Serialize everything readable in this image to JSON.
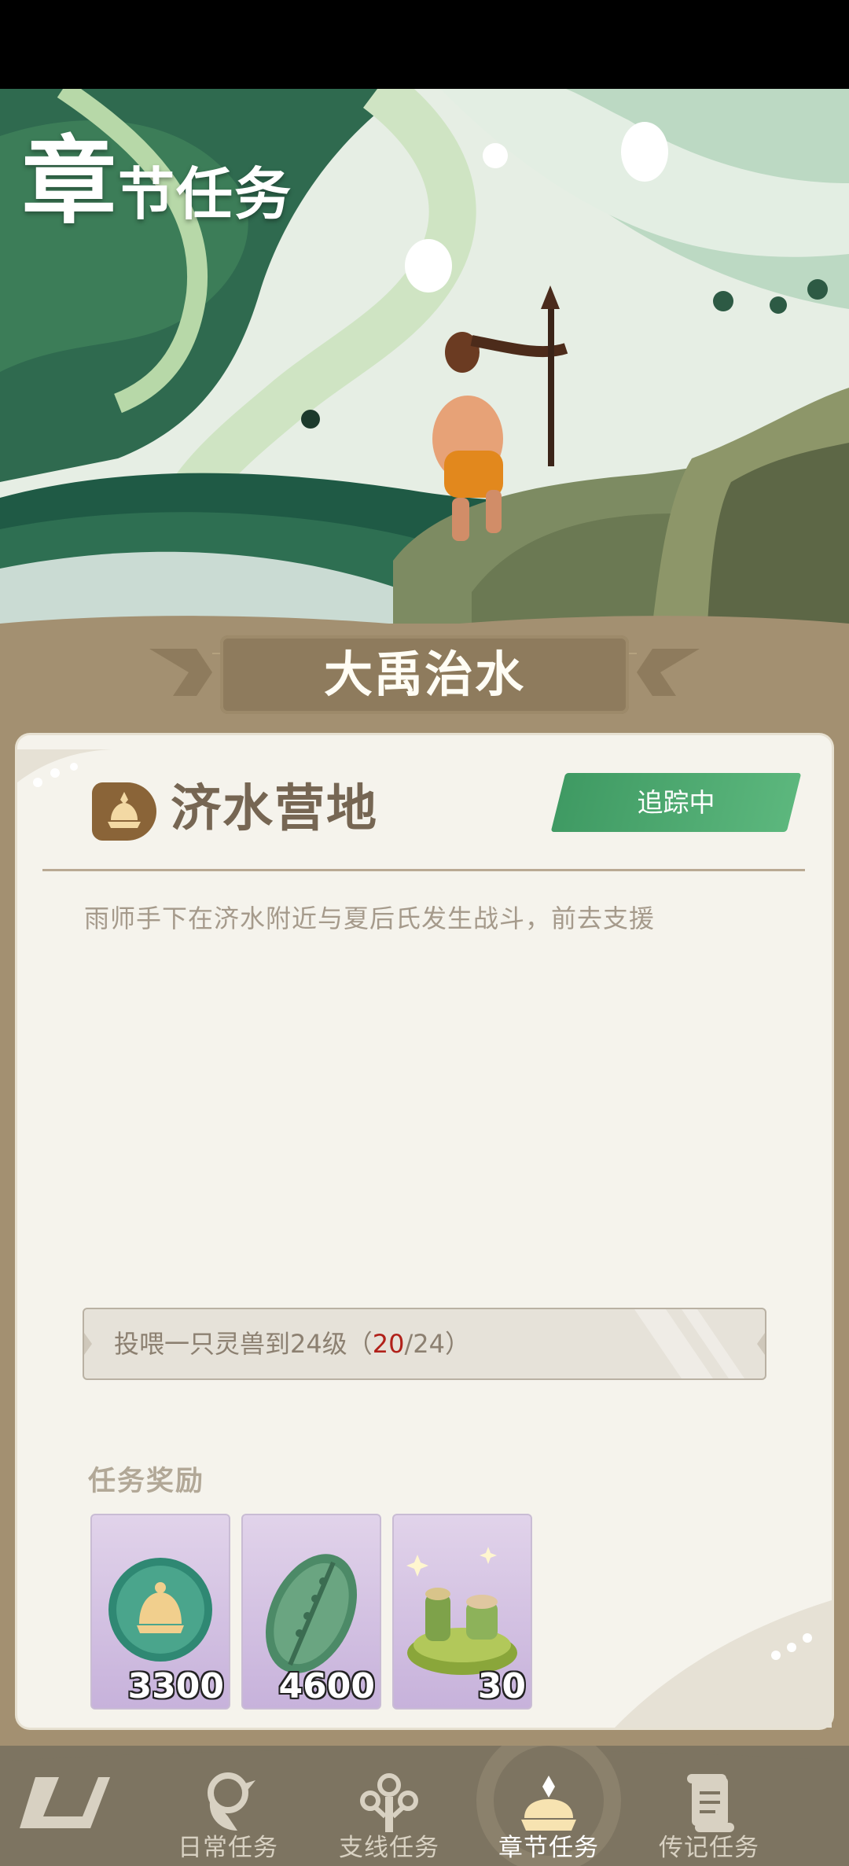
{
  "colors": {
    "background": "#a39071",
    "card": "#f5f3ec",
    "tracking_green": "#4ca86f",
    "progress_current": "#b1211a",
    "reward_purple": "#d2c1e4",
    "nav": "#7d7461"
  },
  "header": {
    "title_first_char": "章",
    "title_rest": "节任务"
  },
  "chapter": {
    "title": "大禹治水"
  },
  "quest": {
    "icon": "camp-icon",
    "stage_name": "济水营地",
    "tracking_label": "追踪中",
    "description": "雨师手下在济水附近与夏后氏发生战斗，前去支援",
    "objective": {
      "text": "投喂一只灵兽到24级",
      "open_paren": "（",
      "current": "20",
      "separator": "/",
      "total": "24",
      "close_paren": "）"
    }
  },
  "rewards": {
    "title": "任务奖励",
    "items": [
      {
        "icon": "coin-icon",
        "count": "3300"
      },
      {
        "icon": "leaf-token-icon",
        "count": "4600"
      },
      {
        "icon": "food-platter-icon",
        "count": "30"
      }
    ]
  },
  "nav": {
    "items": [
      {
        "icon": "logo-icon",
        "label": ""
      },
      {
        "icon": "bird-icon",
        "label": "日常任务"
      },
      {
        "icon": "branch-icon",
        "label": "支线任务"
      },
      {
        "icon": "chapter-icon",
        "label": "章节任务",
        "active": true
      },
      {
        "icon": "scroll-icon",
        "label": "传记任务"
      }
    ]
  }
}
